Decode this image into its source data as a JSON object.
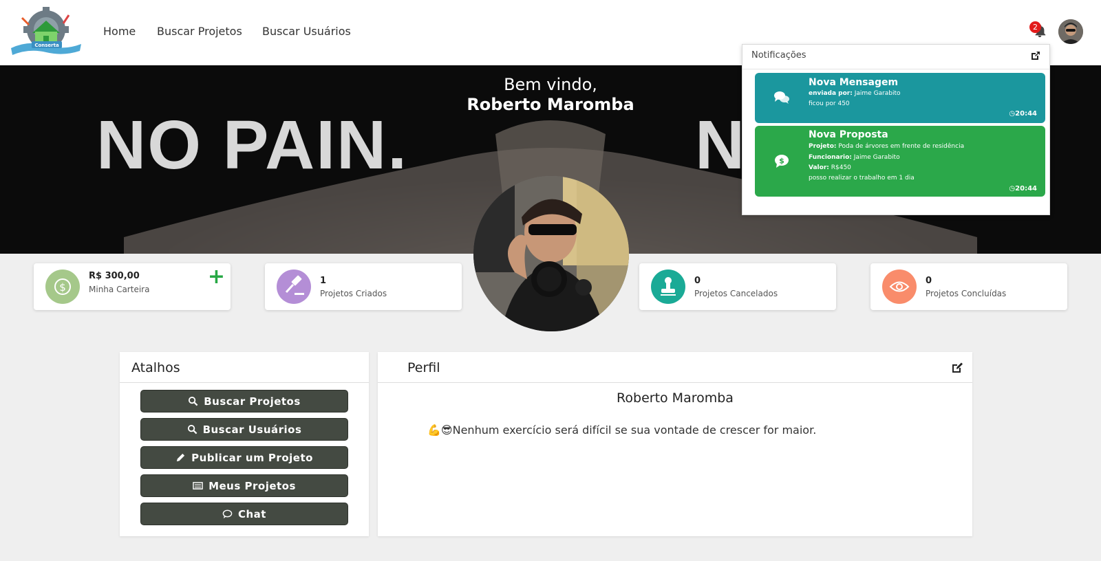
{
  "nav": {
    "logo_text": "Conserta",
    "links": [
      "Home",
      "Buscar Projetos",
      "Buscar Usuários"
    ],
    "notification_count": "2"
  },
  "banner": {
    "welcome": "Bem vindo,",
    "user_name": "Roberto Maromba",
    "background_text_left": "NO PAIN.",
    "background_text_right": "N"
  },
  "stats": [
    {
      "value": "R$ 300,00",
      "label": "Minha Carteira",
      "icon": "dollar-icon",
      "color": "#a5c88a"
    },
    {
      "value": "1",
      "label": "Projetos Criados",
      "icon": "gavel-icon",
      "color": "#b48ed6"
    },
    {
      "value": "0",
      "label": "Projetos Cancelados",
      "icon": "stamp-icon",
      "color": "#1aaa96"
    },
    {
      "value": "0",
      "label": "Projetos Concluídas",
      "icon": "eye-icon",
      "color": "#f98c6b"
    }
  ],
  "shortcuts": {
    "title": "Atalhos",
    "buttons": [
      "Buscar Projetos",
      "Buscar Usuários",
      "Publicar um Projeto",
      "Meus Projetos",
      "Chat"
    ]
  },
  "profile": {
    "title": "Perfil",
    "name": "Roberto Maromba",
    "bio_emoji": "💪😎",
    "bio": "Nenhum exercício será difícil se sua vontade de crescer for maior."
  },
  "notifications": {
    "title": "Notificações",
    "items": [
      {
        "title": "Nova Mensagem",
        "lines": [
          {
            "label": "enviada por:",
            "value": "Jaime Garabito"
          },
          {
            "label": "",
            "value": "ficou por 450"
          }
        ],
        "time": "20:44",
        "color": "#1b979e",
        "icon": "chat-icon"
      },
      {
        "title": "Nova Proposta",
        "lines": [
          {
            "label": "Projeto:",
            "value": "Poda de árvores em frente de residência"
          },
          {
            "label": "Funcionario:",
            "value": "Jaime Garabito"
          },
          {
            "label": "Valor:",
            "value": "R$450"
          },
          {
            "label": "",
            "value": "posso realizar o trabalho em 1 dia"
          }
        ],
        "time": "20:44",
        "color": "#2ba84a",
        "icon": "dollar-chat-icon"
      }
    ]
  }
}
